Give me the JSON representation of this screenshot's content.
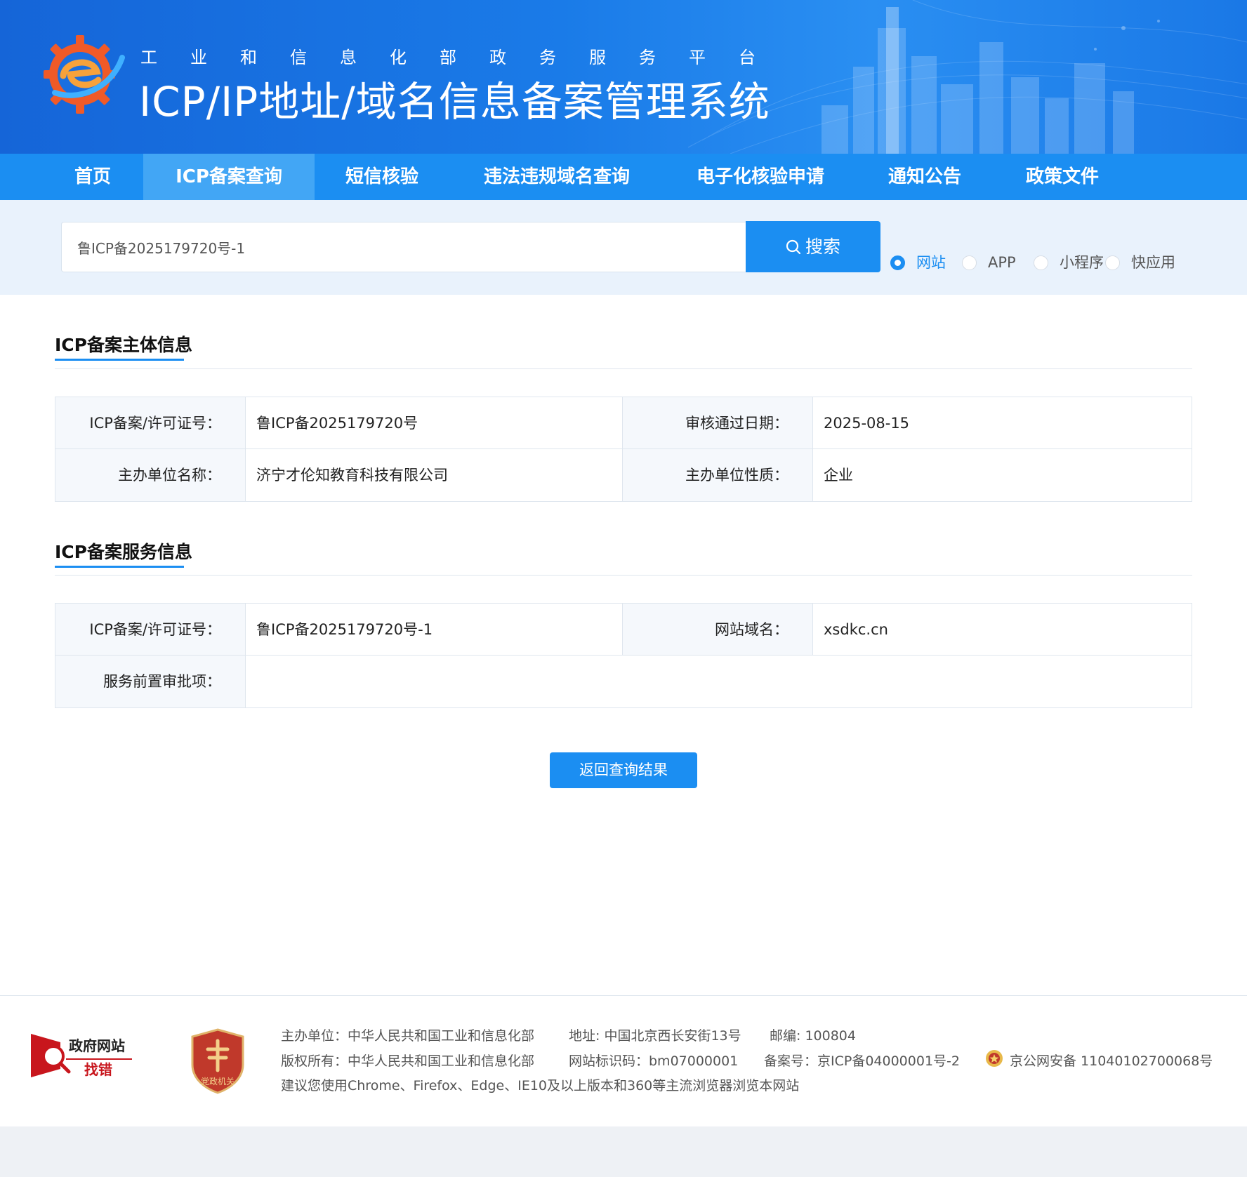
{
  "header": {
    "org_name": "工业和信息化部政务服务平台",
    "system_title": "ICP/IP地址/域名信息备案管理系统",
    "logo_icon": "gear-e-logo-icon"
  },
  "nav": {
    "items": [
      {
        "label": "首页",
        "active": false
      },
      {
        "label": "ICP备案查询",
        "active": true
      },
      {
        "label": "短信核验",
        "active": false
      },
      {
        "label": "违法违规域名查询",
        "active": false
      },
      {
        "label": "电子化核验申请",
        "active": false
      },
      {
        "label": "通知公告",
        "active": false
      },
      {
        "label": "政策文件",
        "active": false
      }
    ]
  },
  "search": {
    "value": "鲁ICP备2025179720号-1",
    "button_label": "搜索",
    "options": [
      {
        "label": "网站",
        "checked": true
      },
      {
        "label": "APP",
        "checked": false
      },
      {
        "label": "小程序",
        "checked": false
      },
      {
        "label": "快应用",
        "checked": false
      }
    ]
  },
  "subject_info": {
    "title": "ICP备案主体信息",
    "license_label": "ICP备案/许可证号：",
    "license_value": "鲁ICP备2025179720号",
    "approve_date_label": "审核通过日期：",
    "approve_date_value": "2025-08-15",
    "org_name_label": "主办单位名称：",
    "org_name_value": "济宁才伦知教育科技有限公司",
    "org_type_label": "主办单位性质：",
    "org_type_value": "企业"
  },
  "service_info": {
    "title": "ICP备案服务信息",
    "license_label": "ICP备案/许可证号：",
    "license_value": "鲁ICP备2025179720号-1",
    "domain_label": "网站域名：",
    "domain_value": "xsdkc.cn",
    "pre_approval_label": "服务前置审批项：",
    "pre_approval_value": ""
  },
  "back_button": "返回查询结果",
  "footer": {
    "gov_logo_line1": "政府网站",
    "gov_logo_line2": "找错",
    "party_logo_text": "党政机关",
    "host": "主办单位：中华人民共和国工业和信息化部",
    "address": "地址: 中国北京西长安街13号",
    "postcode": "邮编: 100804",
    "copyright": "版权所有：中华人民共和国工业和信息化部",
    "site_id": "网站标识码：bm07000001",
    "record_no": "备案号：京ICP备04000001号-2",
    "police_record": "京公网安备 11040102700068号",
    "browser_tip": "建议您使用Chrome、Firefox、Edge、IE10及以上版本和360等主流浏览器浏览本网站"
  },
  "colors": {
    "primary": "#1b8ef2",
    "nav_active": "#42a6f5",
    "search_band": "#e9f2fc",
    "label_bg": "#f5f8fc",
    "logo_orange": "#f05a28"
  }
}
